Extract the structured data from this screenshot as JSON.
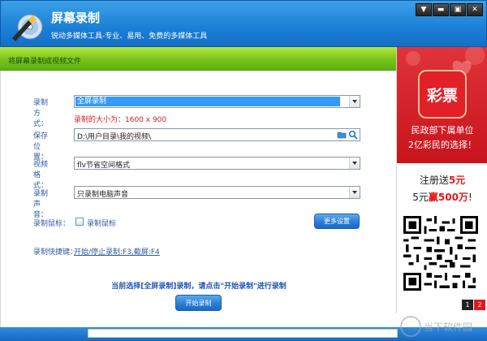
{
  "app": {
    "title": "屏幕录制",
    "subtitle": "锐动多媒体工具-专业、易用、免费的多媒体工具"
  },
  "window_buttons": [
    "▼",
    "▬",
    "▣",
    "✕"
  ],
  "section_title": "将屏幕录制成视频文件",
  "form": {
    "mode": {
      "label": "录制方式：",
      "value": "全屏录制"
    },
    "size_note": "录制的大小为：1600 x 900",
    "save": {
      "label": "保存位置：",
      "value": "D:\\用户目录\\我的视频\\"
    },
    "format": {
      "label": "视频格式：",
      "value": "flv节省空间格式"
    },
    "audio": {
      "label": "录制声音：",
      "value": "只录制电脑声音"
    },
    "cursor": {
      "label": "录制鼠标：",
      "checkbox_label": "录制鼠标"
    },
    "more_settings": "更多设置",
    "shortcut": {
      "label": "录制快捷键：",
      "value": "开始/停止录制:F3,截屏:F4"
    },
    "status": "当前选择[全屏录制]录制，请点击\"开始录制\"进行录制",
    "start_button": "开始录制"
  },
  "ad": {
    "logo_text": "彩票",
    "line1": "民政部下属单位",
    "line2": "2亿彩民的选择！",
    "mid1_a": "注册送",
    "mid1_b": "5元",
    "mid2_a": "5元",
    "mid2_b": "赢500万",
    "mid2_c": "!",
    "pager": [
      "1",
      "2"
    ]
  },
  "watermark": "当下软件园",
  "colors": {
    "title_blue": "#1b7fd6",
    "green_bar": "#77c51a",
    "label_blue": "#2d5aa4",
    "warning_red": "#d42020",
    "ad_red": "#c8141c"
  }
}
